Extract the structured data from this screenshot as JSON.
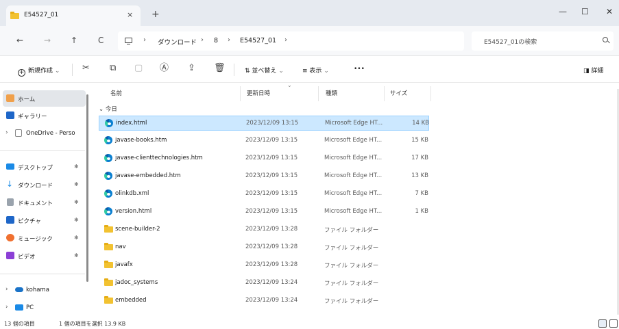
{
  "window": {
    "tab_title": "E54527_01",
    "tab_close": "×",
    "new_tab": "+",
    "minimize": "—",
    "maximize": "☐",
    "close": "✕"
  },
  "nav": {
    "back": "←",
    "forward": "→",
    "up": "↑",
    "refresh": "C"
  },
  "breadcrumb": {
    "sep": "›",
    "items": [
      "ダウンロード",
      "8",
      "E54527_01"
    ]
  },
  "search": {
    "placeholder": "E54527_01の検索"
  },
  "toolbar": {
    "new_label": "新規作成",
    "new_chevron": "⌄",
    "cut_icon": "✂",
    "copy_icon": "⧉",
    "paste_icon": "▢",
    "rename_icon": "Ⓐ",
    "share_icon": "⇪",
    "delete_icon": "🗑",
    "sort_label": "並べ替え",
    "sort_icon": "⇅",
    "view_label": "表示",
    "view_icon": "≡",
    "more": "•••",
    "details_label": "詳細",
    "details_icon": "◨"
  },
  "sidebar": {
    "items": [
      {
        "label": "ホーム",
        "icon": "home-icon",
        "color": "#f0a04b"
      },
      {
        "label": "ギャラリー",
        "icon": "gallery-icon",
        "color": "#1e66c8"
      },
      {
        "label": "OneDrive - Perso",
        "icon": "document-icon",
        "color": "#ffffff"
      },
      {
        "label": "デスクトップ",
        "icon": "desktop-icon",
        "color": "#1a8ae6"
      },
      {
        "label": "ダウンロード",
        "icon": "download-icon",
        "color": "#1a8ae6"
      },
      {
        "label": "ドキュメント",
        "icon": "documents-icon",
        "color": "#9aa3ad"
      },
      {
        "label": "ピクチャ",
        "icon": "pictures-icon",
        "color": "#1e66c8"
      },
      {
        "label": "ミュージック",
        "icon": "music-icon",
        "color": "#f07030"
      },
      {
        "label": "ビデオ",
        "icon": "video-icon",
        "color": "#8c3fd6"
      },
      {
        "label": "kohama",
        "icon": "cloud-icon",
        "color": "#1a73c8"
      },
      {
        "label": "PC",
        "icon": "pc-icon",
        "color": "#1a8ae6"
      }
    ],
    "pin": "✱",
    "expand": "›"
  },
  "columns": {
    "name": "名前",
    "date": "更新日時",
    "type": "種類",
    "size": "サイズ",
    "sort_indicator": "⌄"
  },
  "group": {
    "label": "今日",
    "chevron": "⌄"
  },
  "files": [
    {
      "name": "index.html",
      "date": "2023/12/09 13:15",
      "type": "Microsoft Edge HT...",
      "size": "14 KB",
      "kind": "edge"
    },
    {
      "name": "javase-books.htm",
      "date": "2023/12/09 13:15",
      "type": "Microsoft Edge HT...",
      "size": "15 KB",
      "kind": "edge"
    },
    {
      "name": "javase-clienttechnologies.htm",
      "date": "2023/12/09 13:15",
      "type": "Microsoft Edge HT...",
      "size": "17 KB",
      "kind": "edge"
    },
    {
      "name": "javase-embedded.htm",
      "date": "2023/12/09 13:15",
      "type": "Microsoft Edge HT...",
      "size": "13 KB",
      "kind": "edge"
    },
    {
      "name": "olinkdb.xml",
      "date": "2023/12/09 13:15",
      "type": "Microsoft Edge HT...",
      "size": "7 KB",
      "kind": "edge"
    },
    {
      "name": "version.html",
      "date": "2023/12/09 13:15",
      "type": "Microsoft Edge HT...",
      "size": "1 KB",
      "kind": "edge"
    },
    {
      "name": "scene-builder-2",
      "date": "2023/12/09 13:28",
      "type": "ファイル フォルダー",
      "size": "",
      "kind": "folder"
    },
    {
      "name": "nav",
      "date": "2023/12/09 13:28",
      "type": "ファイル フォルダー",
      "size": "",
      "kind": "folder"
    },
    {
      "name": "javafx",
      "date": "2023/12/09 13:28",
      "type": "ファイル フォルダー",
      "size": "",
      "kind": "folder"
    },
    {
      "name": "jadoc_systems",
      "date": "2023/12/09 13:24",
      "type": "ファイル フォルダー",
      "size": "",
      "kind": "folder"
    },
    {
      "name": "embedded",
      "date": "2023/12/09 13:24",
      "type": "ファイル フォルダー",
      "size": "",
      "kind": "folder"
    }
  ],
  "status": {
    "count": "13 個の項目",
    "selection": "1 個の項目を選択 13.9 KB"
  }
}
